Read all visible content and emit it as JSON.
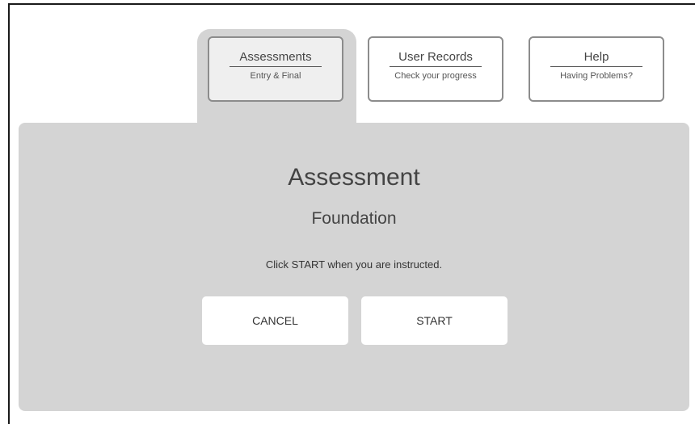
{
  "tabs": [
    {
      "title": "Assessments",
      "subtitle": "Entry & Final",
      "active": true
    },
    {
      "title": "User Records",
      "subtitle": "Check your progress",
      "active": false
    },
    {
      "title": "Help",
      "subtitle": "Having Problems?",
      "active": false
    }
  ],
  "main": {
    "heading": "Assessment",
    "subheading": "Foundation",
    "instruction": "Click START when you are instructed.",
    "cancel_label": "CANCEL",
    "start_label": "START"
  },
  "colors": {
    "panel": "#d4d4d4",
    "tab_border": "#8c8c8c",
    "active_tab_fill": "#efefef",
    "frame_border": "#1a1a1a"
  }
}
